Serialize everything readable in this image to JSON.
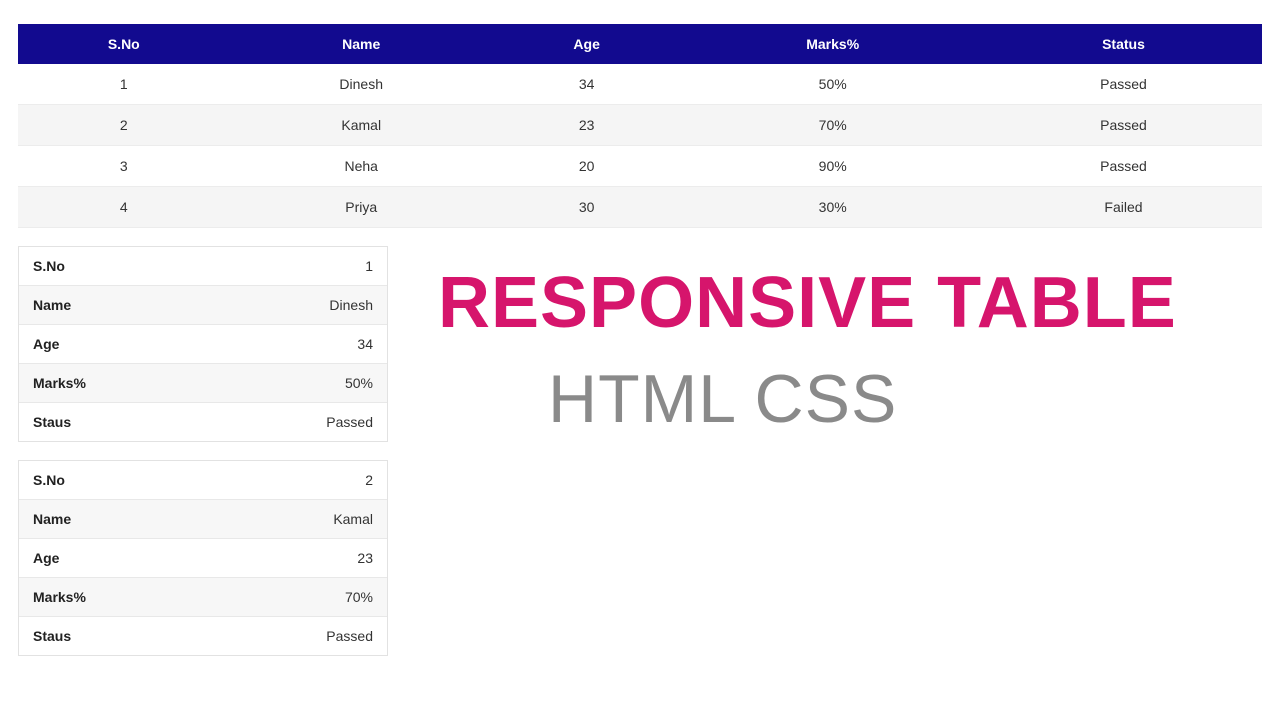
{
  "table": {
    "headers": [
      "S.No",
      "Name",
      "Age",
      "Marks%",
      "Status"
    ],
    "rows": [
      {
        "sno": "1",
        "name": "Dinesh",
        "age": "34",
        "marks": "50%",
        "status": "Passed"
      },
      {
        "sno": "2",
        "name": "Kamal",
        "age": "23",
        "marks": "70%",
        "status": "Passed"
      },
      {
        "sno": "3",
        "name": "Neha",
        "age": "20",
        "marks": "90%",
        "status": "Passed"
      },
      {
        "sno": "4",
        "name": "Priya",
        "age": "30",
        "marks": "30%",
        "status": "Failed"
      }
    ]
  },
  "cardLabels": {
    "sno": "S.No",
    "name": "Name",
    "age": "Age",
    "marks": "Marks%",
    "status": "Staus"
  },
  "cards": [
    {
      "sno": "1",
      "name": "Dinesh",
      "age": "34",
      "marks": "50%",
      "status": "Passed"
    },
    {
      "sno": "2",
      "name": "Kamal",
      "age": "23",
      "marks": "70%",
      "status": "Passed"
    }
  ],
  "headline": {
    "line1": "RESPONSIVE TABLE",
    "line2": "HTML CSS"
  }
}
